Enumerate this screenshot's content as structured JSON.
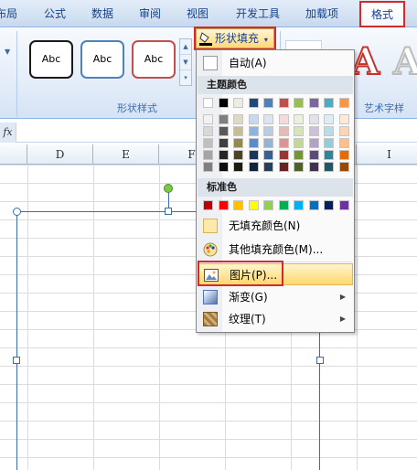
{
  "tabs": [
    {
      "label": "布局",
      "active": false
    },
    {
      "label": "公式",
      "active": false
    },
    {
      "label": "数据",
      "active": false
    },
    {
      "label": "审阅",
      "active": false
    },
    {
      "label": "视图",
      "active": false
    },
    {
      "label": "开发工具",
      "active": false
    },
    {
      "label": "加载项",
      "active": false
    },
    {
      "label": "格式",
      "active": true
    }
  ],
  "ribbon": {
    "shape_styles_caption": "形状样式",
    "wordart_caption": "艺术字样",
    "style_buttons": [
      {
        "label": "Abc",
        "border": "#1a1a1a"
      },
      {
        "label": "Abc",
        "border": "#4f81bd"
      },
      {
        "label": "Abc",
        "border": "#c0504d"
      }
    ],
    "shape_fill_label": "形状填充",
    "wordart_sample": "A"
  },
  "formula_bar": {
    "fx": "fx",
    "value": ""
  },
  "columns": [
    "D",
    "E",
    "F",
    "G",
    "H",
    "I"
  ],
  "menu": {
    "auto_label": "自动(A)",
    "theme_header": "主题颜色",
    "standard_header": "标准色",
    "no_fill_label": "无填充颜色(N)",
    "more_colors_label": "其他填充颜色(M)...",
    "picture_label": "图片(P)...",
    "gradient_label": "渐变(G)",
    "texture_label": "纹理(T)",
    "theme_top": [
      "#ffffff",
      "#000000",
      "#eeece1",
      "#1f497d",
      "#4f81bd",
      "#c0504d",
      "#9bbb59",
      "#8064a2",
      "#4bacc6",
      "#f79646"
    ],
    "theme_shades": [
      [
        "#f2f2f2",
        "#7f7f7f",
        "#ddd9c3",
        "#c6d9f0",
        "#dbe5f1",
        "#f2dcdb",
        "#ebf1dd",
        "#e5e0ec",
        "#dbeef3",
        "#fdeada"
      ],
      [
        "#d8d8d8",
        "#595959",
        "#c4bd97",
        "#8db3e2",
        "#b8cce4",
        "#e5b9b7",
        "#d7e3bc",
        "#ccc1d9",
        "#b7dde8",
        "#fbd5b5"
      ],
      [
        "#bfbfbf",
        "#3f3f3f",
        "#938953",
        "#548dd4",
        "#95b3d7",
        "#d99694",
        "#c3d69b",
        "#b2a2c7",
        "#92cddc",
        "#fac08f"
      ],
      [
        "#a5a5a5",
        "#262626",
        "#494429",
        "#17365d",
        "#366092",
        "#953734",
        "#76923c",
        "#5f497a",
        "#31859b",
        "#e36c09"
      ],
      [
        "#7f7f7f",
        "#0c0c0c",
        "#1d1b10",
        "#0f243e",
        "#244061",
        "#632423",
        "#4f6128",
        "#3f3151",
        "#205867",
        "#974806"
      ]
    ],
    "standard_colors": [
      "#c00000",
      "#ff0000",
      "#ffc000",
      "#ffff00",
      "#92d050",
      "#00b050",
      "#00b0f0",
      "#0070c0",
      "#002060",
      "#7030a0"
    ]
  },
  "colors": {
    "highlight_box": "#d22b2b",
    "accent": "#15428b"
  }
}
